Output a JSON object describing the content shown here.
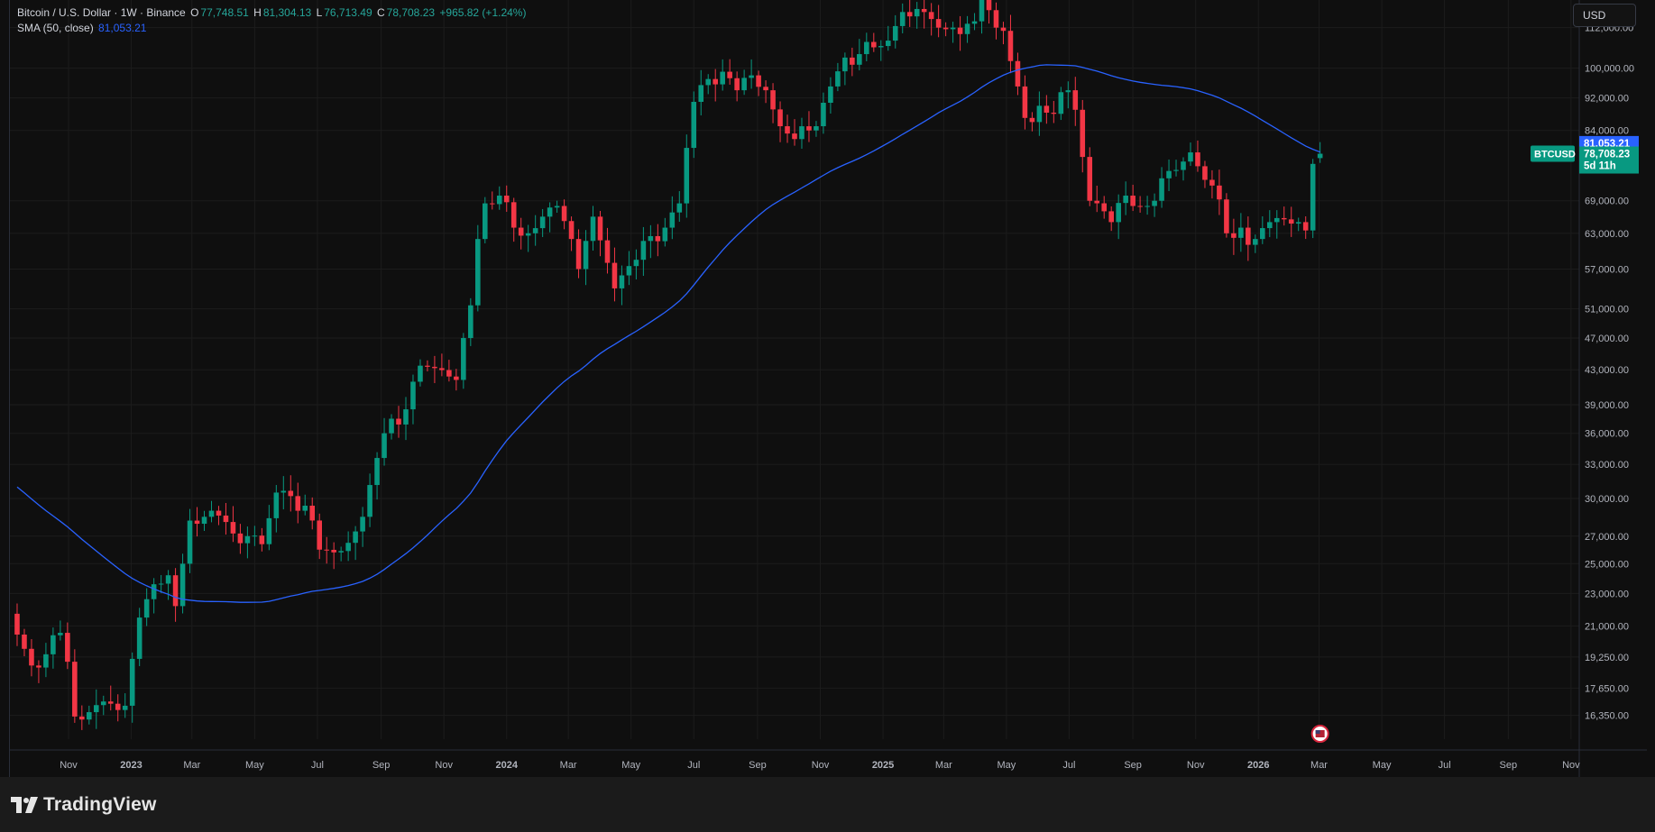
{
  "legend": {
    "title": "Bitcoin / U.S. Dollar · 1W · Binance",
    "o_label": "O",
    "o_value": "77,748.51",
    "h_label": "H",
    "h_value": "81,304.13",
    "l_label": "L",
    "l_value": "76,713.49",
    "c_label": "C",
    "c_value": "78,708.23",
    "change": "+965.82 (+1.24%)",
    "sma_label": "SMA (50, close)",
    "sma_value": "81,053.21"
  },
  "currency_button": "USD",
  "footer": {
    "brand": "TradingView"
  },
  "colors": {
    "background": "#0f0f0f",
    "grid": "#1c1c1c",
    "up": "#089981",
    "down": "#f23645",
    "sma": "#2962ff"
  },
  "icons": {
    "flag": "us-flag-icon",
    "logo": "tradingview-logo-icon"
  },
  "chart_data": {
    "type": "candlestick",
    "symbol": "BTCUSD",
    "interval": "1W",
    "scale": "log",
    "grid": true,
    "y_ticks": [
      112000,
      100000,
      92000,
      84000,
      69000,
      63000,
      57000,
      51000,
      47000,
      43000,
      39000,
      36000,
      33000,
      30000,
      27000,
      25000,
      23000,
      21000,
      19250,
      17650,
      16350
    ],
    "y_tick_labels": [
      "112,000.00",
      "100,000.00",
      "92,000.00",
      "84,000.00",
      "69,000.00",
      "63,000.00",
      "57,000.00",
      "51,000.00",
      "47,000.00",
      "43,000.00",
      "39,000.00",
      "36,000.00",
      "33,000.00",
      "30,000.00",
      "27,000.00",
      "25,000.00",
      "23,000.00",
      "21,000.00",
      "19,250.00",
      "17,650.00",
      "16,350.00"
    ],
    "ylim": [
      15300,
      121000
    ],
    "x_start": "2022-09-05",
    "x_end": "2026-11-09",
    "x_ticks": [
      {
        "date": "2022-11-01",
        "label": "Nov"
      },
      {
        "date": "2023-01-01",
        "label": "2023"
      },
      {
        "date": "2023-03-01",
        "label": "Mar"
      },
      {
        "date": "2023-05-01",
        "label": "May"
      },
      {
        "date": "2023-07-01",
        "label": "Jul"
      },
      {
        "date": "2023-09-01",
        "label": "Sep"
      },
      {
        "date": "2023-11-01",
        "label": "Nov"
      },
      {
        "date": "2024-01-01",
        "label": "2024"
      },
      {
        "date": "2024-03-01",
        "label": "Mar"
      },
      {
        "date": "2024-05-01",
        "label": "May"
      },
      {
        "date": "2024-07-01",
        "label": "Jul"
      },
      {
        "date": "2024-09-01",
        "label": "Sep"
      },
      {
        "date": "2024-11-01",
        "label": "Nov"
      },
      {
        "date": "2025-01-01",
        "label": "2025"
      },
      {
        "date": "2025-03-01",
        "label": "Mar"
      },
      {
        "date": "2025-05-01",
        "label": "May"
      },
      {
        "date": "2025-07-01",
        "label": "Jul"
      },
      {
        "date": "2025-09-01",
        "label": "Sep"
      },
      {
        "date": "2025-11-01",
        "label": "Nov"
      },
      {
        "date": "2026-01-01",
        "label": "2026"
      },
      {
        "date": "2026-03-01",
        "label": "Mar"
      },
      {
        "date": "2026-05-01",
        "label": "May"
      },
      {
        "date": "2026-07-01",
        "label": "Jul"
      },
      {
        "date": "2026-09-01",
        "label": "Sep"
      },
      {
        "date": "2026-11-01",
        "label": "Nov"
      }
    ],
    "first_candle_date": "2022-09-12",
    "close_anchors": [
      [
        0,
        20500
      ],
      [
        2,
        18800
      ],
      [
        4,
        19400
      ],
      [
        6,
        20600
      ],
      [
        7,
        19000
      ],
      [
        8,
        16300
      ],
      [
        10,
        16500
      ],
      [
        12,
        17000
      ],
      [
        14,
        16600
      ],
      [
        15,
        16800
      ],
      [
        17,
        21500
      ],
      [
        19,
        23600
      ],
      [
        21,
        24200
      ],
      [
        22,
        22200
      ],
      [
        24,
        28200
      ],
      [
        26,
        28500
      ],
      [
        28,
        28600
      ],
      [
        30,
        27200
      ],
      [
        32,
        27000
      ],
      [
        34,
        26400
      ],
      [
        36,
        30500
      ],
      [
        38,
        30200
      ],
      [
        40,
        29400
      ],
      [
        42,
        26000
      ],
      [
        44,
        25800
      ],
      [
        46,
        26500
      ],
      [
        48,
        28500
      ],
      [
        50,
        33600
      ],
      [
        52,
        37500
      ],
      [
        54,
        38500
      ],
      [
        56,
        43500
      ],
      [
        58,
        43200
      ],
      [
        60,
        42200
      ],
      [
        61,
        41800
      ],
      [
        62,
        47000
      ],
      [
        63,
        51500
      ],
      [
        64,
        62000
      ],
      [
        65,
        68500
      ],
      [
        67,
        70000
      ],
      [
        69,
        64000
      ],
      [
        71,
        63000
      ],
      [
        73,
        66000
      ],
      [
        75,
        68000
      ],
      [
        77,
        62000
      ],
      [
        78,
        57000
      ],
      [
        80,
        66000
      ],
      [
        82,
        58000
      ],
      [
        83,
        54000
      ],
      [
        84,
        56000
      ],
      [
        86,
        58500
      ],
      [
        88,
        62500
      ],
      [
        90,
        64000
      ],
      [
        92,
        68500
      ],
      [
        93,
        80000
      ],
      [
        94,
        91000
      ],
      [
        96,
        97000
      ],
      [
        98,
        99000
      ],
      [
        100,
        94000
      ],
      [
        102,
        98000
      ],
      [
        104,
        94000
      ],
      [
        106,
        85000
      ],
      [
        108,
        82000
      ],
      [
        110,
        84000
      ],
      [
        111,
        85000
      ],
      [
        113,
        95000
      ],
      [
        115,
        103000
      ],
      [
        117,
        104000
      ],
      [
        119,
        106000
      ],
      [
        121,
        108000
      ],
      [
        123,
        117000
      ],
      [
        125,
        118000
      ],
      [
        126,
        117000
      ],
      [
        128,
        112000
      ],
      [
        130,
        112000
      ],
      [
        131,
        110000
      ],
      [
        133,
        114000
      ],
      [
        134,
        123000
      ],
      [
        136,
        112000
      ],
      [
        137,
        111000
      ],
      [
        138,
        102000
      ],
      [
        139,
        95000
      ],
      [
        140,
        87000
      ],
      [
        141,
        86000
      ],
      [
        142,
        90000
      ],
      [
        144,
        88000
      ],
      [
        146,
        94000
      ],
      [
        147,
        89000
      ],
      [
        148,
        78000
      ],
      [
        149,
        69000
      ],
      [
        151,
        67000
      ],
      [
        152,
        65000
      ],
      [
        154,
        70000
      ],
      [
        155,
        68000
      ],
      [
        157,
        68000
      ],
      [
        158,
        69000
      ],
      [
        160,
        75000
      ],
      [
        162,
        77000
      ],
      [
        163,
        79000
      ],
      [
        164,
        76000
      ],
      [
        166,
        72000
      ],
      [
        168,
        63000
      ],
      [
        170,
        64000
      ],
      [
        171,
        61000
      ],
      [
        172,
        62000
      ],
      [
        174,
        65000
      ],
      [
        176,
        65500
      ],
      [
        178,
        65000
      ],
      [
        179,
        63500
      ],
      [
        180,
        76500
      ],
      [
        181,
        78708
      ]
    ],
    "last_candle": {
      "open": 77748.51,
      "high": 81304.13,
      "low": 76713.49,
      "close": 78708.23
    },
    "sma_label_value": 81053.21,
    "price_labels": {
      "sma_price": "81,053.21",
      "close_price": "78,708.23",
      "countdown": "5d 11h",
      "symbol_tag": "BTCUSD"
    }
  }
}
